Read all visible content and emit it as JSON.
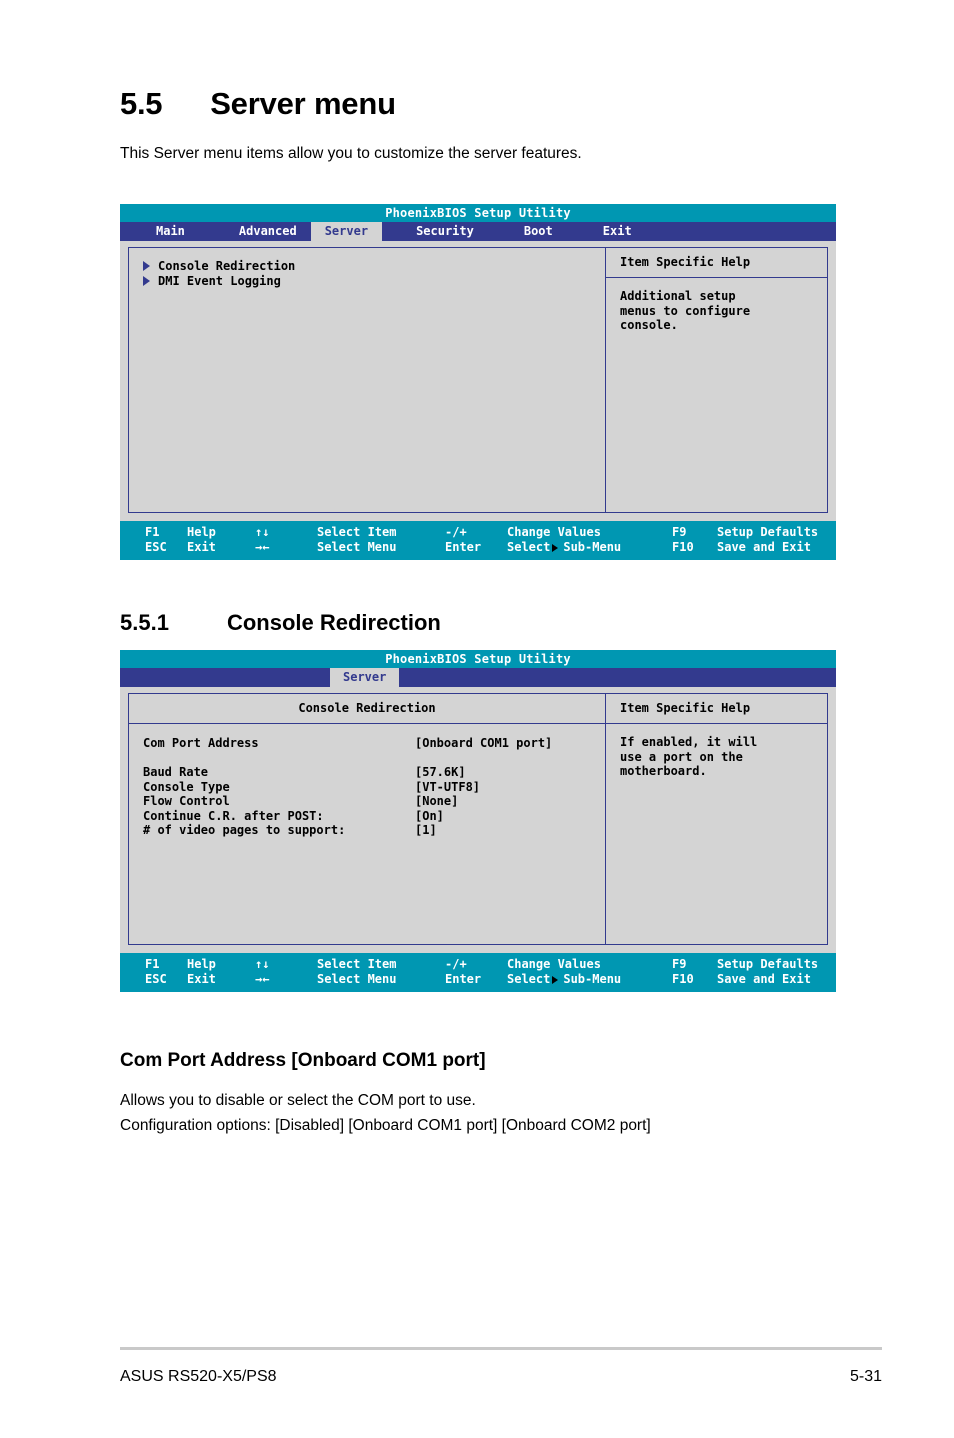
{
  "document": {
    "section_number": "5.5",
    "section_title": "Server menu",
    "intro": "This Server menu items allow you to customize the server features.",
    "subsection_number": "5.5.1",
    "subsection_title": "Console Redirection"
  },
  "bios_common": {
    "utility_title": "PhoenixBIOS Setup Utility",
    "help_panel_title": "Item Specific Help",
    "legend": {
      "row1": {
        "key1": "F1",
        "action1": "Help",
        "keys2": "↑↓",
        "action2": "Select Item",
        "keys3": "-/+",
        "action3": "Change Values",
        "key4": "F9",
        "action4": "Setup Defaults"
      },
      "row2": {
        "key1": "ESC",
        "action1": "Exit",
        "keys2": "→←",
        "action2": "Select Menu",
        "keys3": "Enter",
        "action3_pre": "Select",
        "action3_post": "Sub-Menu",
        "key4": "F10",
        "action4": "Save and Exit"
      }
    }
  },
  "screen1": {
    "tabs": [
      {
        "label": "Main",
        "active": false
      },
      {
        "label": "Advanced",
        "active": false
      },
      {
        "label": "Server",
        "active": true
      },
      {
        "label": "Security",
        "active": false
      },
      {
        "label": "Boot",
        "active": false
      },
      {
        "label": "Exit",
        "active": false
      }
    ],
    "items": [
      {
        "label": "Console Redirection",
        "icon": "submenu-triangle-icon"
      },
      {
        "label": "DMI Event Logging",
        "icon": "submenu-triangle-icon"
      }
    ],
    "help_lines": [
      "Additional setup",
      "menus to configure",
      "console."
    ]
  },
  "screen2": {
    "active_tab": "Server",
    "panel_title": "Console Redirection",
    "settings": [
      {
        "name": "Com Port Address",
        "value": "[Onboard COM1 port]",
        "spacer_after": true
      },
      {
        "name": "Baud Rate",
        "value": "[57.6K]",
        "spacer_after": false
      },
      {
        "name": "Console Type",
        "value": "[VT-UTF8]",
        "spacer_after": false
      },
      {
        "name": "Flow Control",
        "value": "[None]",
        "spacer_after": false
      },
      {
        "name": "Continue C.R. after POST:",
        "value": "[On]",
        "spacer_after": false
      },
      {
        "name": "# of video pages to support:",
        "value": "[1]",
        "spacer_after": false
      }
    ],
    "help_lines": [
      "If enabled, it will",
      "use a port on the",
      "motherboard."
    ]
  },
  "descriptions": {
    "heading": "Com Port Address [Onboard COM1 port]",
    "line1": "Allows you to disable or select the COM port to use.",
    "line2": "Configuration options: [Disabled] [Onboard COM1 port] [Onboard COM2 port]"
  },
  "page_footer": {
    "product": "ASUS RS520-X5/PS8",
    "page_number": "5-31"
  },
  "colors": {
    "title_bar": "#0097b2",
    "menu_bar": "#333a8e",
    "panel_bg": "#d4d4d4",
    "border": "#333a8e"
  }
}
